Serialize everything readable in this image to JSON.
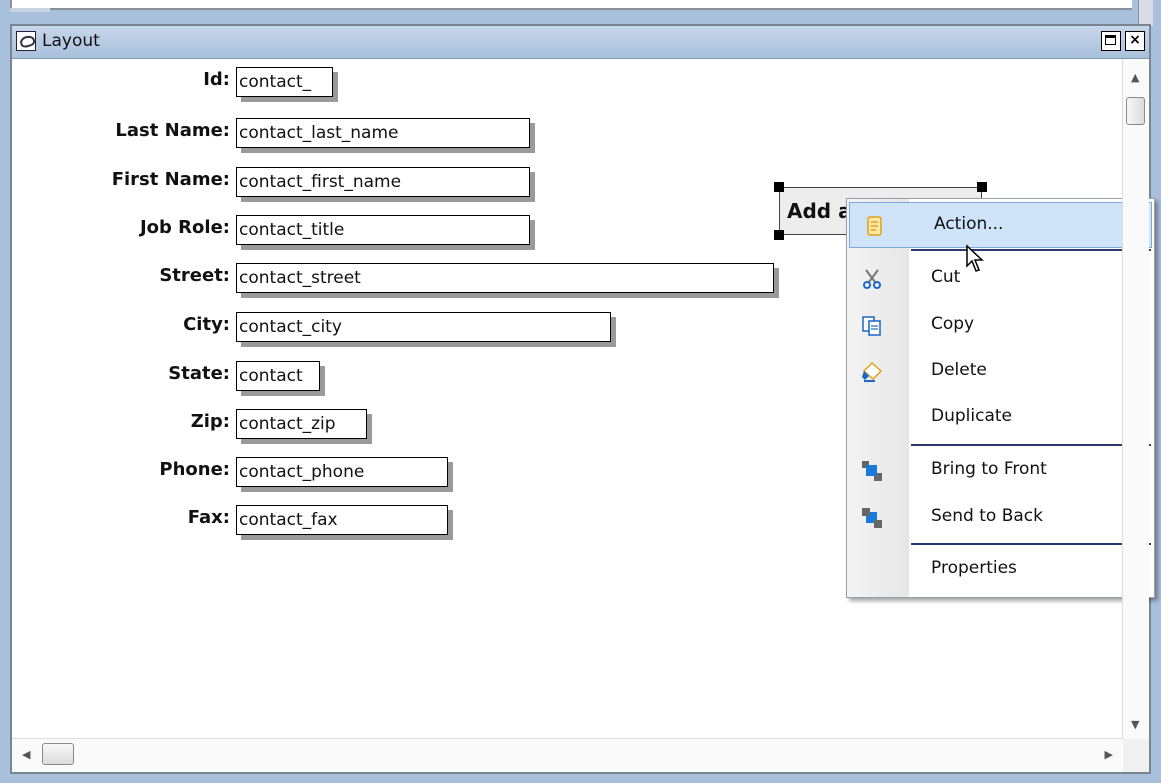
{
  "window": {
    "title": "Layout",
    "maximize_label": "",
    "close_label": "×"
  },
  "form": {
    "fields": [
      {
        "label": "Id:",
        "value": "contact_"
      },
      {
        "label": "Last Name:",
        "value": "contact_last_name"
      },
      {
        "label": "First Name:",
        "value": "contact_first_name"
      },
      {
        "label": "Job Role:",
        "value": "contact_title"
      },
      {
        "label": "Street:",
        "value": "contact_street"
      },
      {
        "label": "City:",
        "value": "contact_city"
      },
      {
        "label": "State:",
        "value": "contact"
      },
      {
        "label": "Zip:",
        "value": "contact_zip"
      },
      {
        "label": "Phone:",
        "value": "contact_phone"
      },
      {
        "label": "Fax:",
        "value": "contact_fax"
      }
    ],
    "button_label": "Add a contact"
  },
  "context_menu": {
    "items": [
      {
        "label": "Action...",
        "icon": "action-icon",
        "selected": true
      },
      {
        "label": "Cut",
        "icon": "cut-icon"
      },
      {
        "label": "Copy",
        "icon": "copy-icon"
      },
      {
        "label": "Delete",
        "icon": "delete-icon"
      },
      {
        "label": "Duplicate",
        "icon": ""
      },
      {
        "label": "Bring to Front",
        "icon": "bring-to-front-icon"
      },
      {
        "label": "Send to Back",
        "icon": "send-to-back-icon"
      },
      {
        "label": "Properties",
        "icon": ""
      }
    ]
  },
  "colors": {
    "titlebar": "#a9c0dc",
    "menu_highlight": "#cfe3f9",
    "separator": "#2a3a6e"
  }
}
